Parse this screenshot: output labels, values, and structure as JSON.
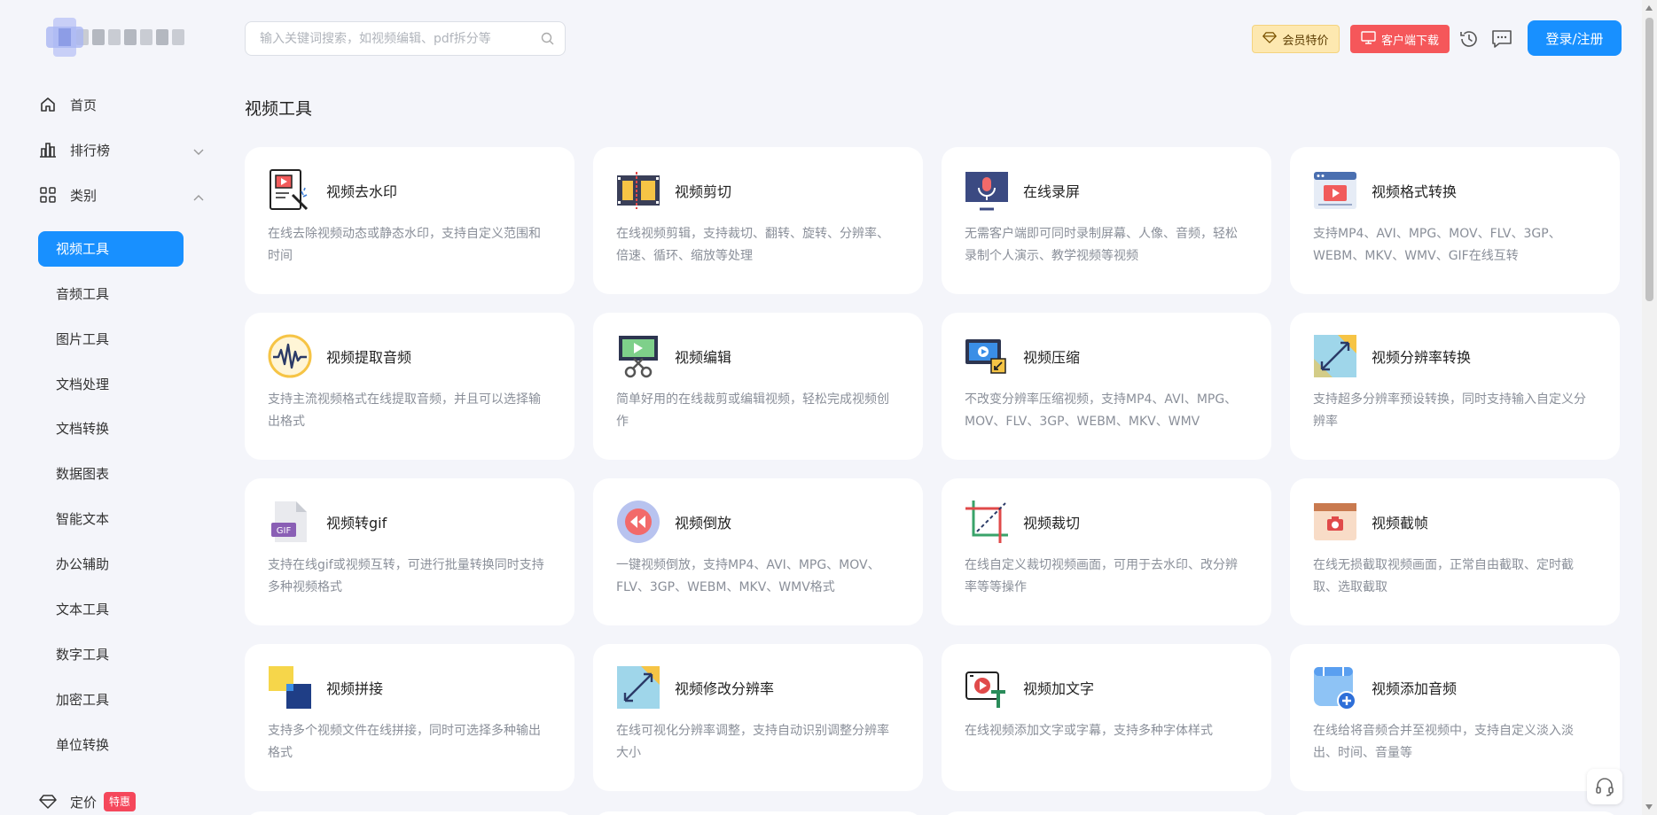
{
  "sidebar": {
    "nav": [
      {
        "label": "首页",
        "icon": "home-icon"
      },
      {
        "label": "排行榜",
        "icon": "bar-chart-icon"
      },
      {
        "label": "类别",
        "icon": "grid-icon"
      }
    ],
    "categories": [
      "视频工具",
      "音频工具",
      "图片工具",
      "文档处理",
      "文档转换",
      "数据图表",
      "智能文本",
      "办公辅助",
      "文本工具",
      "数字工具",
      "加密工具",
      "单位转换"
    ],
    "active_category": "视频工具",
    "pricing": {
      "label": "定价",
      "badge": "特惠",
      "icon": "diamond-icon"
    }
  },
  "header": {
    "search_placeholder": "输入关键词搜索，如视频编辑、pdf拆分等",
    "vip_label": "会员特价",
    "download_label": "客户端下载",
    "login_label": "登录/注册",
    "accent": "#1890ff",
    "download_color": "#f5575a",
    "vip_color": "#fde8b0"
  },
  "section_title": "视频工具",
  "tools": [
    {
      "title": "视频去水印",
      "desc": "在线去除视频动态或静态水印，支持自定义范围和时间",
      "icon": "video-watermark-icon"
    },
    {
      "title": "视频剪切",
      "desc": "在线视频剪辑，支持裁切、翻转、旋转、分辨率、倍速、循环、缩放等处理",
      "icon": "film-cut-icon"
    },
    {
      "title": "在线录屏",
      "desc": "无需客户端即可同时录制屏幕、人像、音频，轻松录制个人演示、教学视频等视频",
      "icon": "screen-record-icon"
    },
    {
      "title": "视频格式转换",
      "desc": "支持MP4、AVI、MPG、MOV、FLV、3GP、WEBM、MKV、WMV、GIF在线互转",
      "icon": "video-format-icon"
    },
    {
      "title": "视频提取音频",
      "desc": "支持主流视频格式在线提取音频，并且可以选择输出格式",
      "icon": "audio-wave-icon"
    },
    {
      "title": "视频编辑",
      "desc": "简单好用的在线裁剪或编辑视频，轻松完成视频创作",
      "icon": "video-edit-icon"
    },
    {
      "title": "视频压缩",
      "desc": "不改变分辨率压缩视频，支持MP4、AVI、MPG、MOV、FLV、3GP、WEBM、MKV、WMV",
      "icon": "video-compress-icon"
    },
    {
      "title": "视频分辨率转换",
      "desc": "支持超多分辨率预设转换，同时支持输入自定义分辨率",
      "icon": "resolution-convert-icon"
    },
    {
      "title": "视频转gif",
      "desc": "支持在线gif或视频互转，可进行批量转换同时支持多种视频格式",
      "icon": "gif-file-icon"
    },
    {
      "title": "视频倒放",
      "desc": "一键视频倒放，支持MP4、AVI、MPG、MOV、FLV、3GP、WEBM、MKV、WMV格式",
      "icon": "rewind-icon"
    },
    {
      "title": "视频裁切",
      "desc": "在线自定义裁切视频画面，可用于去水印、改分辨率等等操作",
      "icon": "crop-icon"
    },
    {
      "title": "视频截帧",
      "desc": "在线无损截取视频画面，正常自由截取、定时截取、选取截取",
      "icon": "frame-capture-icon"
    },
    {
      "title": "视频拼接",
      "desc": "支持多个视频文件在线拼接，同时可选择多种输出格式",
      "icon": "video-merge-icon"
    },
    {
      "title": "视频修改分辨率",
      "desc": "在线可视化分辨率调整，支持自动识别调整分辨率大小",
      "icon": "resolution-edit-icon"
    },
    {
      "title": "视频加文字",
      "desc": "在线视频添加文字或字幕，支持多种字体样式",
      "icon": "video-text-icon"
    },
    {
      "title": "视频添加音频",
      "desc": "在线给将音频合并至视频中，支持自定义淡入淡出、时间、音量等",
      "icon": "add-audio-icon"
    }
  ]
}
